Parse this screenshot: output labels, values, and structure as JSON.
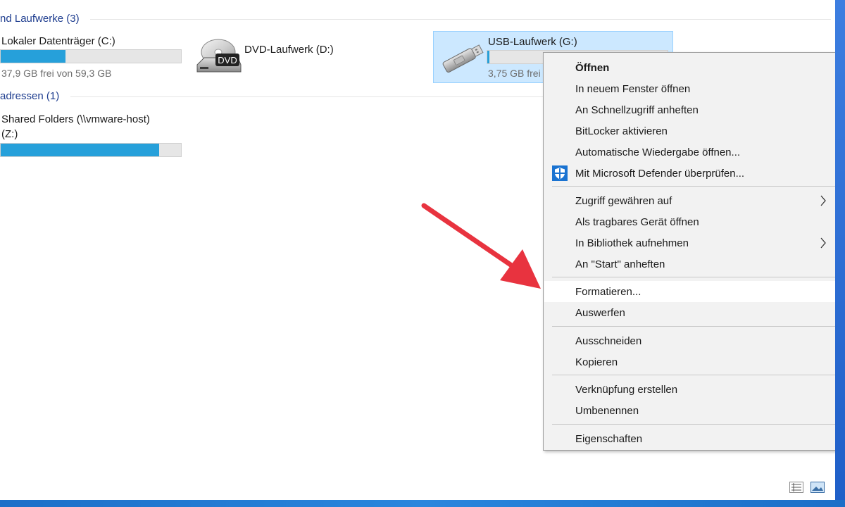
{
  "groups": {
    "drives_header": "nd Laufwerke (3)",
    "network_header": "adressen (1)"
  },
  "drives": [
    {
      "name": "Lokaler Datenträger (C:)",
      "free": "37,9 GB frei von 59,3 GB",
      "used_fraction": 0.36
    },
    {
      "name": "DVD-Laufwerk (D:)"
    },
    {
      "name": "USB-Laufwerk (G:)",
      "free": "3,75 GB frei",
      "used_fraction": 0.01
    }
  ],
  "network": [
    {
      "name_line1": "Shared Folders (\\\\vmware-host)",
      "name_line2": "(Z:)",
      "used_fraction": 0.88
    }
  ],
  "dvd_label": "DVD",
  "context_menu": {
    "items": [
      {
        "label": "Öffnen",
        "bold": true
      },
      {
        "label": "In neuem Fenster öffnen"
      },
      {
        "label": "An Schnellzugriff anheften"
      },
      {
        "label": "BitLocker aktivieren"
      },
      {
        "label": "Automatische Wiedergabe öffnen..."
      },
      {
        "label": "Mit Microsoft Defender überprüfen...",
        "icon": "defender-shield-icon"
      },
      {
        "label": "Zugriff gewähren auf",
        "submenu": true
      },
      {
        "label": "Als tragbares Gerät öffnen"
      },
      {
        "label": "In Bibliothek aufnehmen",
        "submenu": true
      },
      {
        "label": "An \"Start\" anheften"
      },
      {
        "label": "Formatieren...",
        "highlighted": true
      },
      {
        "label": "Auswerfen"
      },
      {
        "label": "Ausschneiden"
      },
      {
        "label": "Kopieren"
      },
      {
        "label": "Verknüpfung erstellen"
      },
      {
        "label": "Umbenennen"
      },
      {
        "label": "Eigenschaften"
      }
    ]
  },
  "colors": {
    "accent": "#26a0da",
    "selection": "#cce8ff",
    "arrow": "#e8333f",
    "header_text": "#1e3d8f"
  }
}
